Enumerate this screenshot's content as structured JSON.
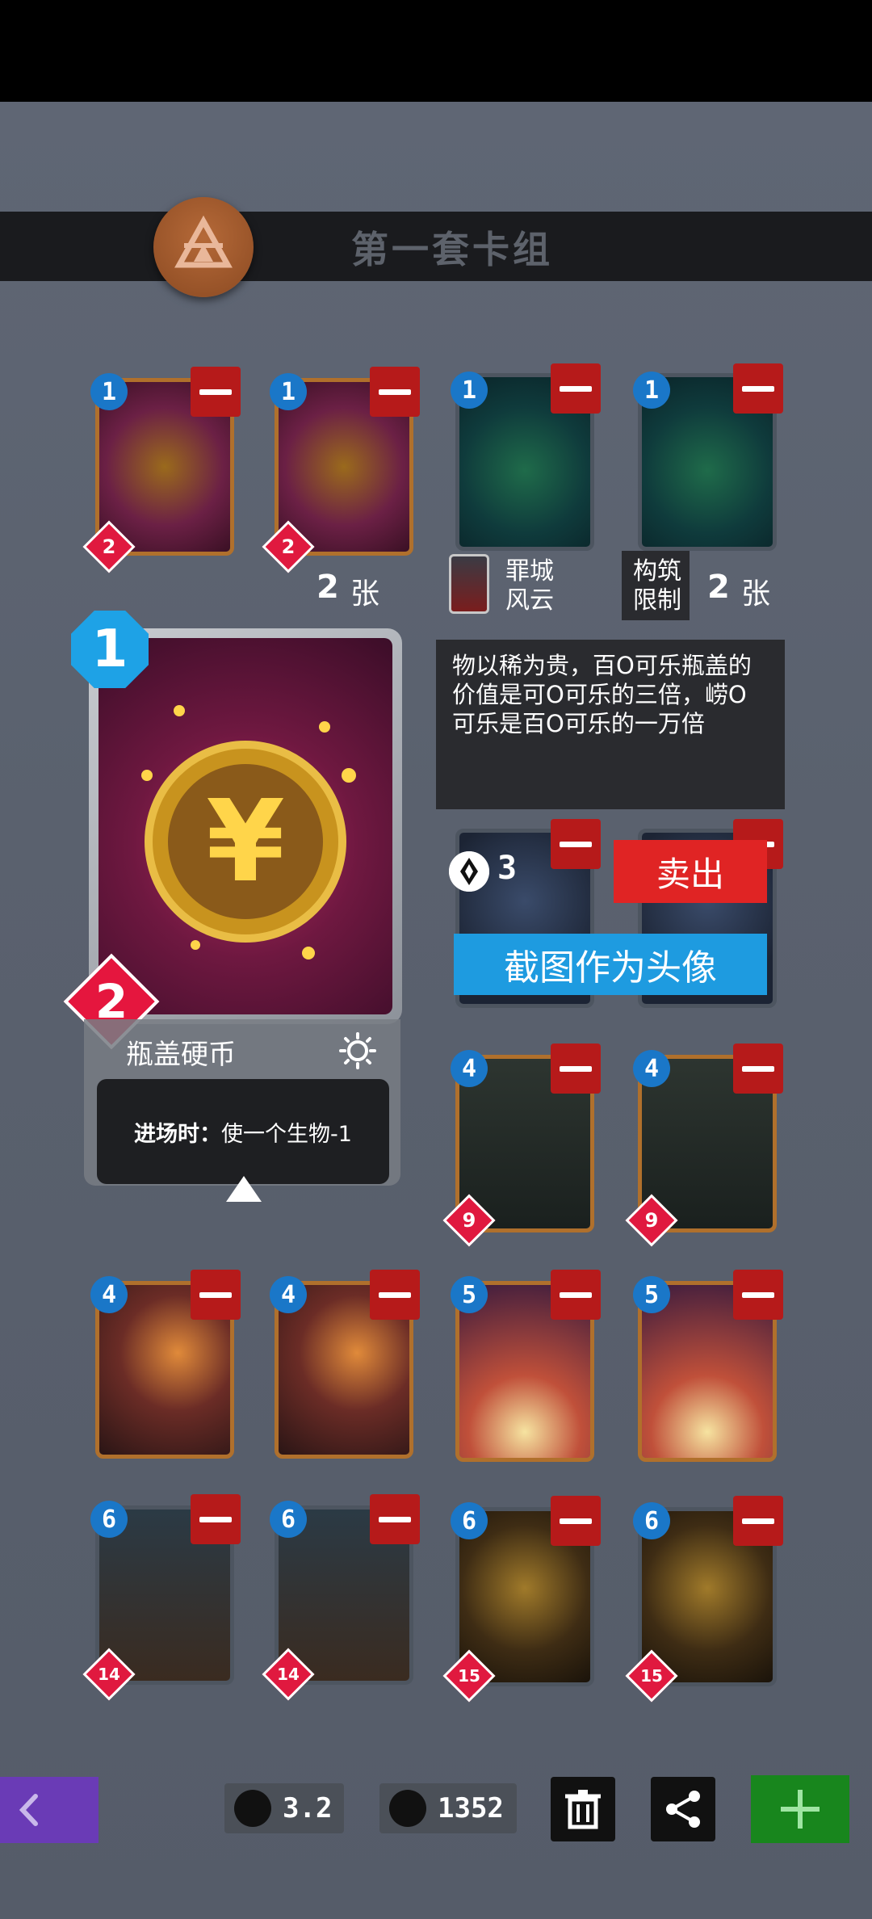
{
  "deck": {
    "title": "第一套卡组"
  },
  "cards": [
    {
      "cost": "1",
      "gem": "2",
      "theme": "cap"
    },
    {
      "cost": "1",
      "gem": "2",
      "theme": "cap"
    },
    {
      "cost": "1",
      "gem": "",
      "theme": "teal"
    },
    {
      "cost": "1",
      "gem": "",
      "theme": "teal"
    },
    {
      "cost": "4",
      "gem": "9",
      "theme": "robot"
    },
    {
      "cost": "4",
      "gem": "9",
      "theme": "robot"
    },
    {
      "cost": "4",
      "gem": "",
      "theme": "blade"
    },
    {
      "cost": "4",
      "gem": "",
      "theme": "blade"
    },
    {
      "cost": "5",
      "gem": "",
      "theme": "stage"
    },
    {
      "cost": "5",
      "gem": "",
      "theme": "stage"
    },
    {
      "cost": "6",
      "gem": "14",
      "theme": "boss"
    },
    {
      "cost": "6",
      "gem": "14",
      "theme": "boss"
    },
    {
      "cost": "6",
      "gem": "15",
      "theme": "frog"
    },
    {
      "cost": "6",
      "gem": "15",
      "theme": "frog"
    }
  ],
  "counts": {
    "left_count": "2",
    "right_count": "2",
    "unit": "张"
  },
  "faction": {
    "line1": "罪城",
    "line2": "风云"
  },
  "limit": {
    "line1": "构筑",
    "line2": "限制"
  },
  "detail": {
    "cost": "1",
    "gem": "2",
    "name": "瓶盖硬币",
    "effect_label": "进场时：",
    "effect_text": "使一个生物-1",
    "description": "物以稀为贵，百O可乐瓶盖的价值是可O可乐的三倍，崂O可乐是百O可乐的一万倍",
    "price": "3",
    "sell_label": "卖出",
    "avatar_label": "截图作为头像"
  },
  "bottom": {
    "avg_cost": "3.2",
    "coins": "1352"
  },
  "colors": {
    "accent_blue": "#1e9be0",
    "sell_red": "#e02424",
    "add_green": "#18861d",
    "back_purple": "#6a3bb6"
  }
}
